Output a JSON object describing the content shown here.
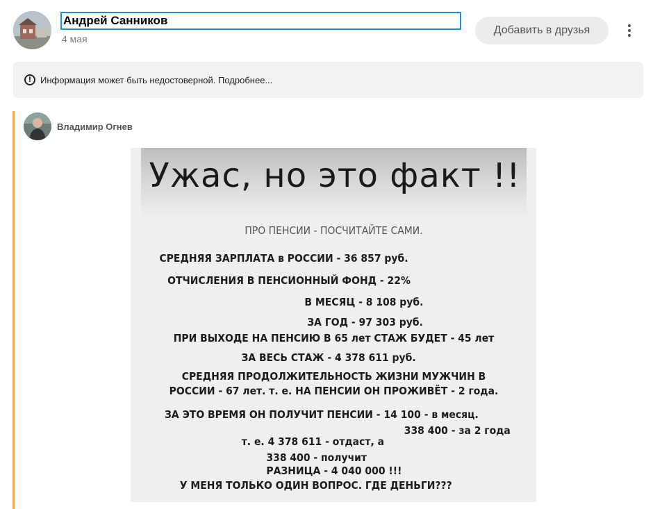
{
  "post": {
    "author": "Андрей Санников",
    "date": "4 мая",
    "add_friend_label": "Добавить в друзья",
    "more_menu": "more-vertical-icon"
  },
  "notice": {
    "icon": "warning-circle-icon",
    "text": "Информация может быть недостоверной. ",
    "more_link": "Подробнее..."
  },
  "repost": {
    "author": "Владимир Огнев",
    "accent_color": "#f0a95a"
  },
  "image": {
    "title": "Ужас, но это факт !!",
    "lines": [
      "ПРО ПЕНСИИ - ПОСЧИТАЙТЕ САМИ.",
      "СРЕДНЯЯ ЗАРПЛАТА в РОССИИ - 36 857 руб.",
      "ОТЧИСЛЕНИЯ В ПЕНСИОННЫЙ ФОНД - 22%",
      "В МЕСЯЦ - 8 108 руб.",
      "ЗА ГОД - 97 303 руб.",
      "ПРИ ВЫХОДЕ НА ПЕНСИЮ В 65 лет СТАЖ БУДЕТ - 45 лет",
      "ЗА ВЕСЬ СТАЖ - 4 378 611 руб.",
      "СРЕДНЯЯ ПРОДОЛЖИТЕЛЬНОСТЬ ЖИЗНИ МУЖЧИН В",
      "РОССИИ - 67 лет. т. е. НА ПЕНСИИ ОН ПРОЖИВЁТ - 2 года.",
      "ЗА ЭТО ВРЕМЯ ОН ПОЛУЧИТ ПЕНСИИ - 14 100 - в месяц.",
      "338 400 - за 2 года",
      "т. е.  4 378 611 - отдаст, а",
      "338 400 - получит",
      "РАЗНИЦА - 4 040 000 !!!",
      "У МЕНЯ ТОЛЬКО ОДИН ВОПРОС.  ГДЕ ДЕНЬГИ???"
    ]
  }
}
